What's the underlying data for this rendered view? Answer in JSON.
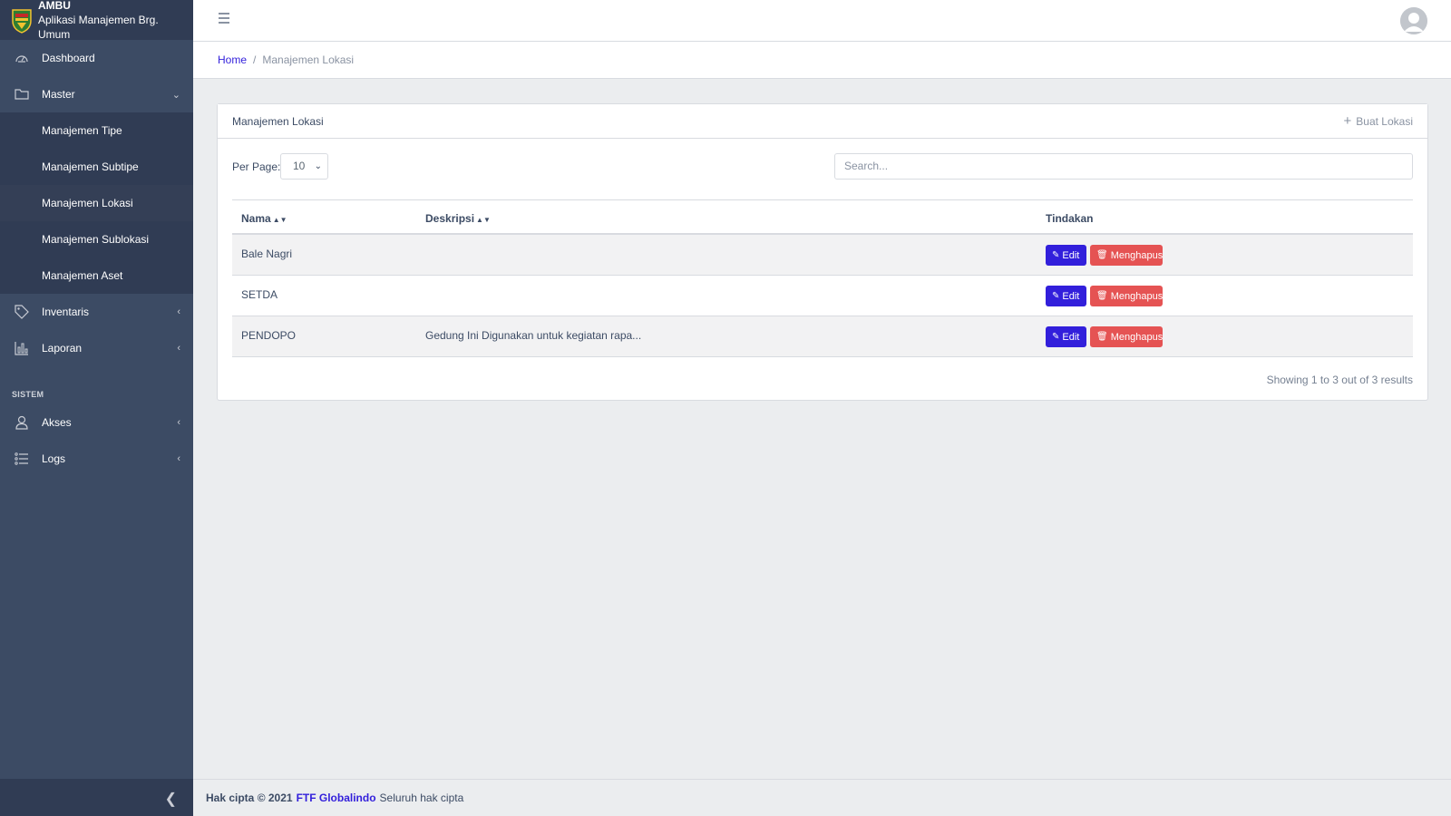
{
  "brand": {
    "title": "AMBU",
    "subtitle": "Aplikasi Manajemen Brg. Umum"
  },
  "sidebar": {
    "items": [
      {
        "label": "Dashboard",
        "icon": "speedometer-icon"
      },
      {
        "label": "Master",
        "icon": "folder-icon",
        "chevron": "⌄"
      },
      {
        "label": "Inventaris",
        "icon": "tag-icon",
        "chevron": "‹"
      },
      {
        "label": "Laporan",
        "icon": "bar-chart-icon",
        "chevron": "‹"
      }
    ],
    "submenu": [
      {
        "label": "Manajemen Tipe"
      },
      {
        "label": "Manajemen Subtipe"
      },
      {
        "label": "Manajemen Lokasi",
        "active": true
      },
      {
        "label": "Manajemen Sublokasi"
      },
      {
        "label": "Manajemen Aset"
      }
    ],
    "section_title": "SISTEM",
    "system_items": [
      {
        "label": "Akses",
        "icon": "user-icon",
        "chevron": "‹"
      },
      {
        "label": "Logs",
        "icon": "list-icon",
        "chevron": "‹"
      }
    ],
    "colors": {
      "bg": "#3c4b64",
      "dark": "#303c54"
    }
  },
  "breadcrumb": {
    "home": "Home",
    "separator": "/",
    "current": "Manajemen Lokasi"
  },
  "card": {
    "title": "Manajemen Lokasi",
    "create_label": "Buat Lokasi",
    "per_page_label": "Per Page:",
    "per_page_value": "10",
    "search_placeholder": "Search..."
  },
  "table": {
    "headers": {
      "name": "Nama",
      "description": "Deskripsi",
      "actions": "Tindakan"
    },
    "rows": [
      {
        "name": "Bale Nagri",
        "description": ""
      },
      {
        "name": "SETDA",
        "description": ""
      },
      {
        "name": "PENDOPO",
        "description": "Gedung Ini Digunakan untuk kegiatan rapa..."
      }
    ],
    "edit_label": "Edit",
    "delete_label": "Menghapus",
    "results_text": "Showing 1 to 3 out of 3 results"
  },
  "footer": {
    "copyright": "Hak cipta © 2021",
    "company": "FTF Globalindo",
    "rights": "Seluruh hak cipta"
  },
  "accent": {
    "primary": "#321fdb",
    "danger": "#e55353"
  }
}
